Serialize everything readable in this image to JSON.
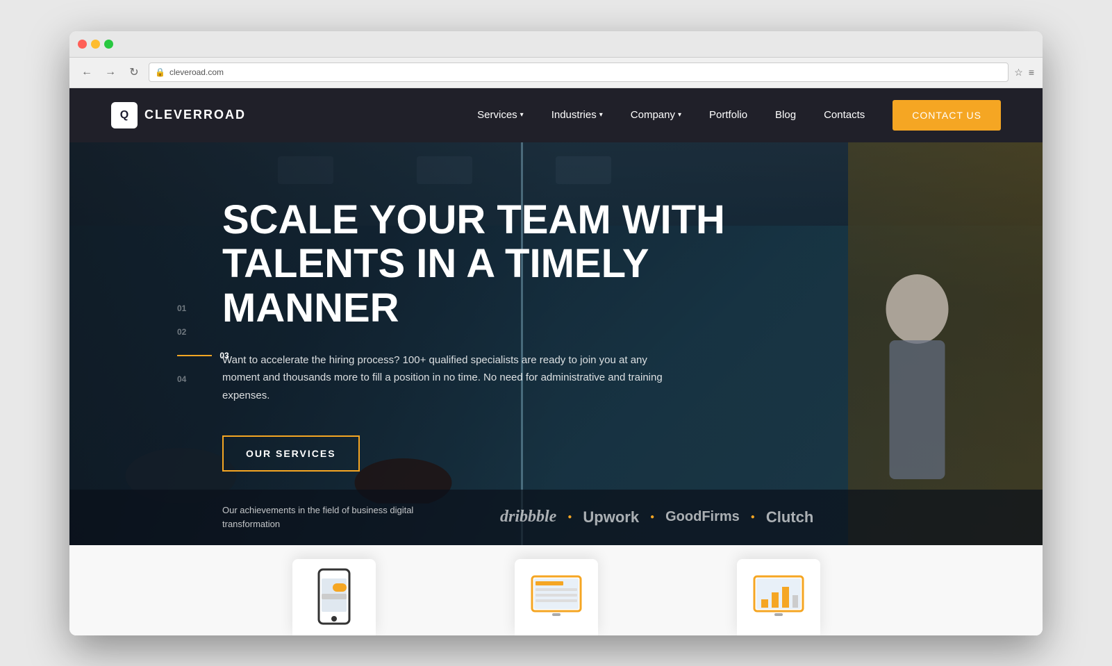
{
  "browser": {
    "address": "cleveroad.com",
    "back_label": "←",
    "forward_label": "→",
    "refresh_label": "↻"
  },
  "navbar": {
    "logo_text": "CLEVERROAD",
    "logo_icon": "Q",
    "nav_items": [
      {
        "label": "Services",
        "has_dropdown": true,
        "id": "services"
      },
      {
        "label": "Industries",
        "has_dropdown": true,
        "id": "industries"
      },
      {
        "label": "Company",
        "has_dropdown": true,
        "id": "company"
      },
      {
        "label": "Portfolio",
        "has_dropdown": false,
        "id": "portfolio"
      },
      {
        "label": "Blog",
        "has_dropdown": false,
        "id": "blog"
      },
      {
        "label": "Contacts",
        "has_dropdown": false,
        "id": "contacts"
      }
    ],
    "cta_label": "CONTACT US"
  },
  "hero": {
    "slide_numbers": [
      "01",
      "02",
      "03",
      "04"
    ],
    "active_slide": "03",
    "title": "SCALE YOUR TEAM WITH TALENTS IN A TIMELY MANNER",
    "description": "Want to accelerate the hiring process? 100+ qualified specialists are ready to join you at any moment and thousands more to fill a position in no time. No need for administrative and training expenses.",
    "cta_label": "OUR SERVICES",
    "achievement_text": "Our achievements in the field of business digital transformation",
    "partners": [
      "dribbble",
      "Upwork",
      "GoodFirms",
      "Clutch"
    ]
  },
  "colors": {
    "accent": "#f5a623",
    "dark_bg": "#0d1520",
    "nav_bg": "#14141e"
  }
}
